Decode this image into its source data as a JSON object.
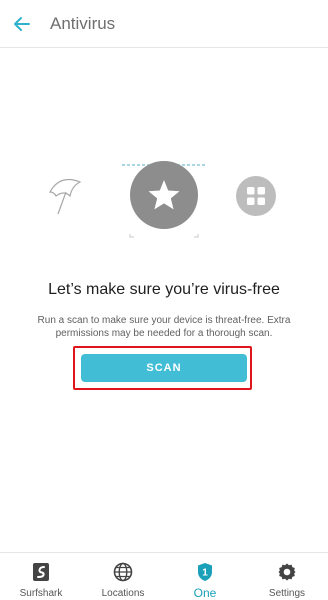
{
  "header": {
    "title": "Antivirus",
    "back_icon": "arrow-left-icon"
  },
  "illustration": {
    "left_icon": "umbrella-icon",
    "center_icon": "star-icon",
    "right_icon": "apps-grid-icon"
  },
  "main": {
    "headline": "Let’s make sure you’re virus-free",
    "description": "Run a scan to make sure your device is threat-free. Extra permissions may be needed for a thorough scan.",
    "scan_label": "SCAN"
  },
  "bottom_nav": {
    "items": [
      {
        "label": "Surfshark",
        "icon": "surfshark-logo-icon"
      },
      {
        "label": "Locations",
        "icon": "globe-icon"
      },
      {
        "label": "One",
        "icon": "shield-badge-icon",
        "badge": "1",
        "active": true
      },
      {
        "label": "Settings",
        "icon": "gear-icon"
      }
    ]
  },
  "colors": {
    "accent": "#41bdd5",
    "accent_dark": "#1aa0b8",
    "highlight": "#e0141b",
    "text_primary": "#1f1f1f",
    "text_secondary": "#606060",
    "icon_gray": "#bdbdbd"
  }
}
